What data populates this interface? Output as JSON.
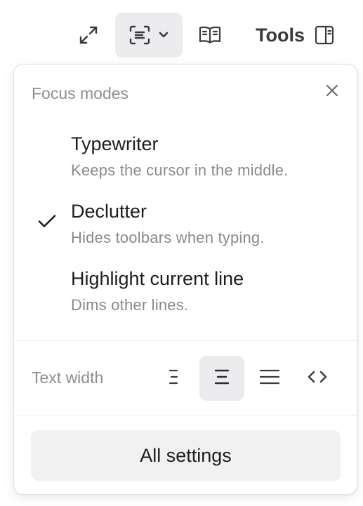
{
  "toolbar": {
    "expand_icon": "expand-arrows-icon",
    "focus_icon": "focus-mode-icon",
    "focus_menu_icon": "chevron-down-icon",
    "reader_icon": "book-open-icon",
    "tools_label": "Tools",
    "sidebar_icon": "sidebar-right-icon"
  },
  "popover": {
    "title": "Focus modes",
    "close_icon": "close-icon",
    "modes": [
      {
        "name": "Typewriter",
        "description": "Keeps the cursor in the middle.",
        "checked": false
      },
      {
        "name": "Declutter",
        "description": "Hides toolbars when typing.",
        "checked": true
      },
      {
        "name": "Highlight current line",
        "description": "Dims other lines.",
        "checked": false
      }
    ],
    "text_width": {
      "label": "Text width",
      "options": [
        {
          "id": "narrow",
          "icon": "text-width-narrow-icon",
          "selected": false
        },
        {
          "id": "medium",
          "icon": "text-width-medium-icon",
          "selected": true
        },
        {
          "id": "wide",
          "icon": "text-width-wide-icon",
          "selected": false
        },
        {
          "id": "full",
          "icon": "code-brackets-icon",
          "selected": false
        }
      ]
    },
    "all_settings_label": "All settings"
  },
  "colors": {
    "accent_bg": "#ececee",
    "muted_text": "#8e8e93",
    "primary_text": "#1d1d1f"
  }
}
